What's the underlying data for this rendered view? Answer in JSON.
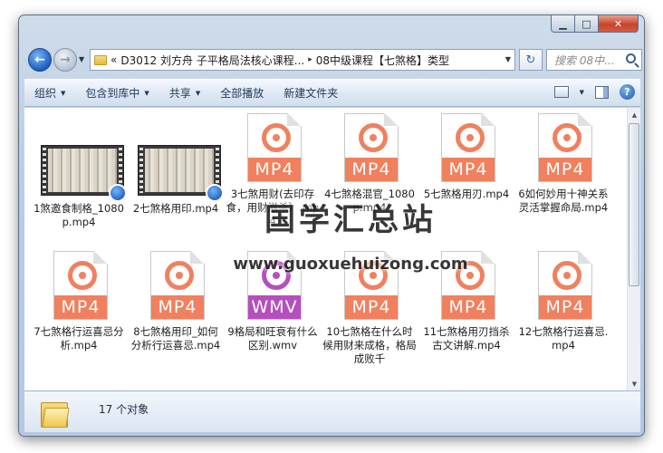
{
  "window": {
    "controls": {
      "minimize": "▁",
      "maximize": "□",
      "close": "✕"
    }
  },
  "nav": {
    "back_glyph": "←",
    "forward_glyph": "→",
    "address_prefix": "«",
    "breadcrumb": [
      "D3012 刘方舟 子平格局法核心课程...",
      "08中级课程【七煞格】类型"
    ],
    "breadcrumb_sep": "▸",
    "refresh_glyph": "↻",
    "search_placeholder": "搜索 08中..."
  },
  "toolbar": {
    "organize": "组织",
    "include_library": "包含到库中",
    "share": "共享",
    "play_all": "全部播放",
    "new_folder": "新建文件夹",
    "help": "?"
  },
  "files": [
    {
      "name": "1煞邀食制格_1080p.mp4",
      "type": "video"
    },
    {
      "name": "2七煞格用印.mp4",
      "type": "video"
    },
    {
      "name": "3七煞用财(去印存食，用财滋杀）.mp4",
      "type": "mp4",
      "label": "MP4"
    },
    {
      "name": "4七煞格混官_1080p.mp4",
      "type": "mp4",
      "label": "MP4"
    },
    {
      "name": "5七煞格用刃.mp4",
      "type": "mp4",
      "label": "MP4"
    },
    {
      "name": "6如何妙用十神关系灵活掌握命局.mp4",
      "type": "mp4",
      "label": "MP4"
    },
    {
      "name": "7七煞格行运喜忌分析.mp4",
      "type": "mp4",
      "label": "MP4"
    },
    {
      "name": "8七煞格用印_如何分析行运喜忌.mp4",
      "type": "mp4",
      "label": "MP4"
    },
    {
      "name": "9格局和旺衰有什么区别.wmv",
      "type": "wmv",
      "label": "WMV"
    },
    {
      "name": "10七煞格在什么时候用财来成格，格局成败千",
      "type": "mp4",
      "label": "MP4"
    },
    {
      "name": "11七煞格用刃挡杀古文讲解.mp4",
      "type": "mp4",
      "label": "MP4"
    },
    {
      "name": "12七煞格行运喜忌.mp4",
      "type": "mp4",
      "label": "MP4"
    }
  ],
  "watermark": {
    "title": "国学汇总站",
    "url": "www.guoxuehuizong.com"
  },
  "status": {
    "count_text": "17 个对象"
  },
  "colors": {
    "mp4": "#f0805e",
    "wmv": "#b54fbf",
    "accent": "#1b5fc4"
  }
}
